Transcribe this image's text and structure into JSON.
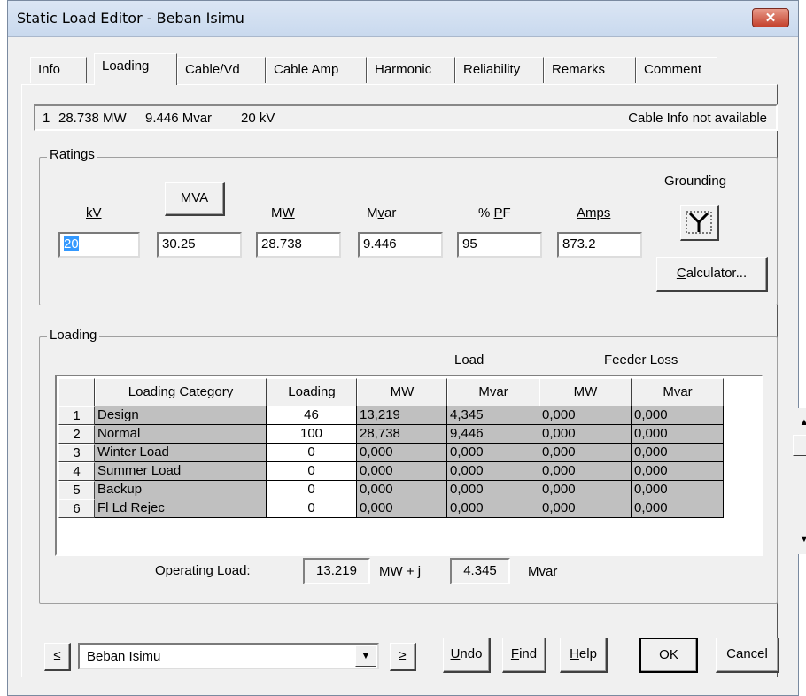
{
  "window": {
    "title": "Static Load Editor - Beban Isimu",
    "close_label": "✕"
  },
  "tabs": [
    "Info",
    "Loading",
    "Cable/Vd",
    "Cable Amp",
    "Harmonic",
    "Reliability",
    "Remarks",
    "Comment"
  ],
  "info_bar": {
    "index": "1",
    "mw": "28.738 MW",
    "mvar": "9.446 Mvar",
    "kv": "20 kV",
    "cable_info": "Cable Info not available"
  },
  "ratings": {
    "group_label": "Ratings",
    "kv_label": "kV",
    "mva_label": "MVA",
    "mw_label": "MW",
    "mvar_label": "Mvar",
    "pf_label": "% PF",
    "amps_label": "Amps",
    "grounding_label": "Grounding",
    "kv_value": "20",
    "mva_value": "30.25",
    "mw_value": "28.738",
    "mvar_value": "9.446",
    "pf_value": "95",
    "amps_value": "873.2",
    "calculator_label": "Calculator..."
  },
  "loading": {
    "group_label": "Loading",
    "load_header": "Load",
    "feeder_loss_header": "Feeder Loss",
    "columns": [
      "Loading Category",
      "Loading",
      "MW",
      "Mvar",
      "MW",
      "Mvar"
    ],
    "rows": [
      {
        "n": "1",
        "category": "Design",
        "loading": "46",
        "mw": "13,219",
        "mvar": "4,345",
        "fl_mw": "0,000",
        "fl_mvar": "0,000"
      },
      {
        "n": "2",
        "category": "Normal",
        "loading": "100",
        "mw": "28,738",
        "mvar": "9,446",
        "fl_mw": "0,000",
        "fl_mvar": "0,000"
      },
      {
        "n": "3",
        "category": "Winter Load",
        "loading": "0",
        "mw": "0,000",
        "mvar": "0,000",
        "fl_mw": "0,000",
        "fl_mvar": "0,000"
      },
      {
        "n": "4",
        "category": "Summer Load",
        "loading": "0",
        "mw": "0,000",
        "mvar": "0,000",
        "fl_mw": "0,000",
        "fl_mvar": "0,000"
      },
      {
        "n": "5",
        "category": "Backup",
        "loading": "0",
        "mw": "0,000",
        "mvar": "0,000",
        "fl_mw": "0,000",
        "fl_mvar": "0,000"
      },
      {
        "n": "6",
        "category": "Fl Ld Rejec",
        "loading": "0",
        "mw": "0,000",
        "mvar": "0,000",
        "fl_mw": "0,000",
        "fl_mvar": "0,000"
      }
    ],
    "operating_load_label": "Operating Load:",
    "operating_mw": "13.219",
    "mw_plus_j": "MW  + j",
    "operating_mvar": "4.345",
    "mvar_unit": "Mvar"
  },
  "footer": {
    "prev_label": "≤",
    "next_label": "≥",
    "combo_value": "Beban Isimu",
    "undo_label": "Undo",
    "find_label": "Find",
    "help_label": "Help",
    "ok_label": "OK",
    "cancel_label": "Cancel"
  }
}
